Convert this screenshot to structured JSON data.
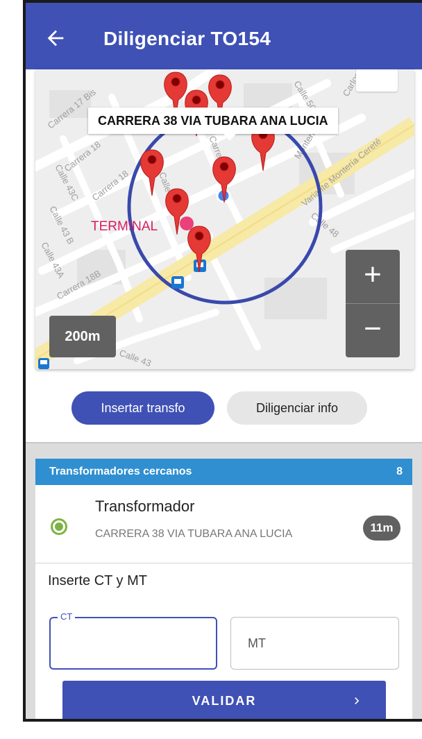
{
  "header": {
    "title": "Diligenciar TO154",
    "back_icon": "arrow-left-icon",
    "color": "#3f51b5"
  },
  "map": {
    "tooltip": "CARRERA 38 VIA TUBARA ANA LUCIA",
    "scale": "200m",
    "zoom_in": "+",
    "zoom_out": "−",
    "poi_label": "TERMINAL",
    "street_labels": [
      "Carrera 17 Bis",
      "Carrera 18",
      "Carrera 18",
      "Calle 43C",
      "Calle 43 B",
      "Calle 43A",
      "Carrera 18B",
      "Calle 47",
      "Carrera 48",
      "Calle 50",
      "Carlos",
      "Variante Montería Cereté",
      "Monteri",
      "Calle 48",
      "Calle 43"
    ],
    "marker_color": "#e53935",
    "circle_color": "#3949ab"
  },
  "actions": {
    "insert_label": "Insertar transfo",
    "fill_label": "Diligenciar info"
  },
  "nearby": {
    "header": "Transformadores cercanos",
    "count": "8",
    "items": [
      {
        "title": "Transformador",
        "address": "CARRERA 38 VIA TUBARA ANA LUCIA",
        "distance": "11m",
        "selected": true
      }
    ]
  },
  "form": {
    "section_label": "Inserte CT y MT",
    "ct_label": "CT",
    "ct_value": "",
    "mt_placeholder": "MT",
    "submit_label": "VALIDAR"
  }
}
